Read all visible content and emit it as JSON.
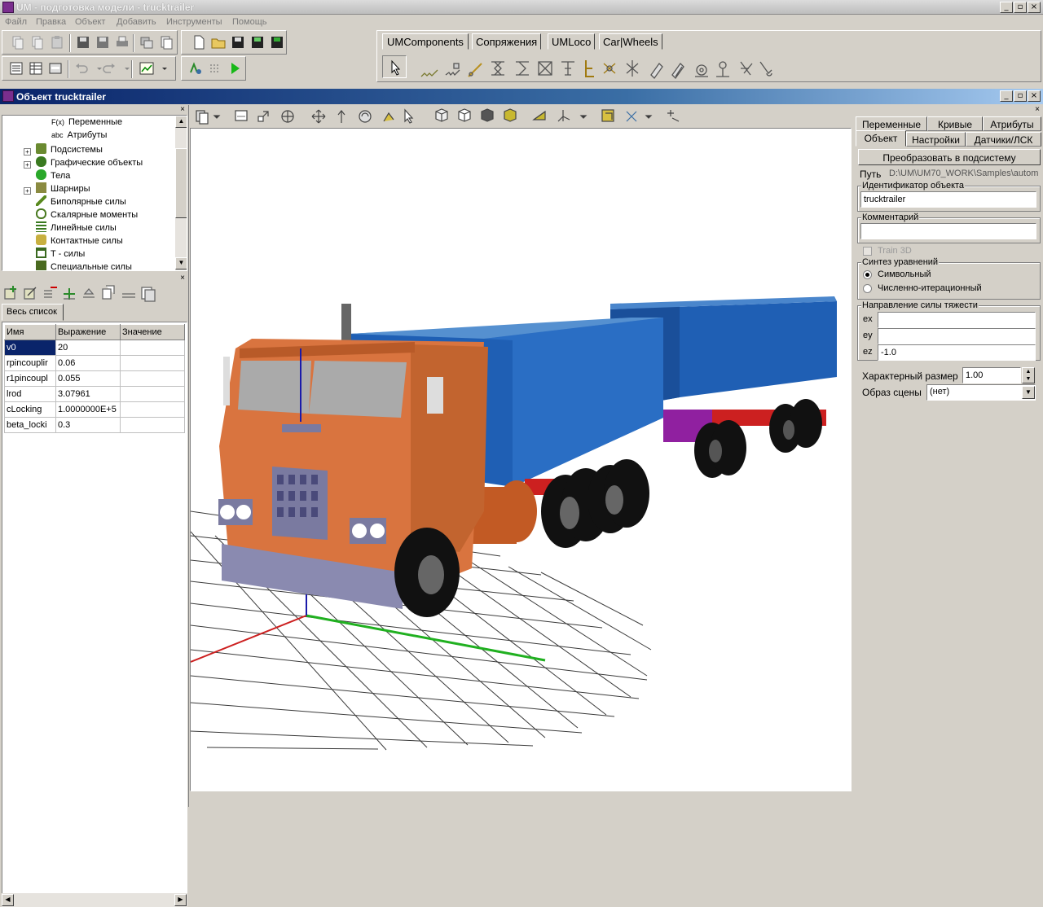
{
  "app": {
    "title": "UM - подготовка модели - trucktrailer",
    "menu": [
      "Файл",
      "Правка",
      "Объект",
      "Добавить",
      "Инструменты",
      "Помощь"
    ]
  },
  "toolbar": {
    "component_tabs": [
      "UMComponents",
      "Сопряжения",
      "UMLoco",
      "Car|Wheels"
    ]
  },
  "object_window": {
    "title": "Объект trucktrailer"
  },
  "tree": {
    "items": [
      {
        "label": "Переменные",
        "icon": "fx-icon",
        "prefix": "F(x)"
      },
      {
        "label": "Атрибуты",
        "icon": "abc-icon",
        "prefix": "abc"
      },
      {
        "label": "Подсистемы",
        "icon": "subsystems-icon"
      },
      {
        "label": "Графические объекты",
        "icon": "graphic-objects-icon"
      },
      {
        "label": "Тела",
        "icon": "bodies-icon"
      },
      {
        "label": "Шарниры",
        "icon": "joints-icon"
      },
      {
        "label": "Биполярные силы",
        "icon": "bipolar-force-icon"
      },
      {
        "label": "Скалярные моменты",
        "icon": "scalar-torque-icon"
      },
      {
        "label": "Линейные силы",
        "icon": "linear-force-icon"
      },
      {
        "label": "Контактные силы",
        "icon": "contact-force-icon"
      },
      {
        "label": "T - силы",
        "icon": "t-force-icon"
      },
      {
        "label": "Специальные силы",
        "icon": "special-force-icon"
      }
    ]
  },
  "variables": {
    "list_tab": "Весь список",
    "headers": [
      "Имя",
      "Выражение",
      "Значение"
    ],
    "rows": [
      {
        "name": "v0",
        "expr": "20",
        "value": ""
      },
      {
        "name": "rpincouplir",
        "expr": "0.06",
        "value": ""
      },
      {
        "name": "r1pincoupl",
        "expr": "0.055",
        "value": ""
      },
      {
        "name": "lrod",
        "expr": "3.07961",
        "value": ""
      },
      {
        "name": "cLocking",
        "expr": "1.0000000E+5",
        "value": ""
      },
      {
        "name": "beta_locki",
        "expr": "0.3",
        "value": ""
      }
    ]
  },
  "inspector": {
    "tabs_row1": [
      "Переменные",
      "Кривые",
      "Атрибуты"
    ],
    "tabs_row2": [
      "Объект",
      "Настройки",
      "Датчики/ЛСК"
    ],
    "convert_button": "Преобразовать в подсистему",
    "path_label": "Путь",
    "path_value": "D:\\UM\\UM70_WORK\\Samples\\autom",
    "identifier_label": "Идентификатор объекта",
    "identifier_value": "trucktrailer",
    "comment_label": "Комментарий",
    "comment_value": "",
    "train3d_label": "Train 3D",
    "synthesis_label": "Синтез уравнений",
    "synthesis_options": [
      "Символьный",
      "Численно-итерационный"
    ],
    "gravity_label": "Направление силы тяжести",
    "gravity": [
      {
        "axis": "ex",
        "value": ""
      },
      {
        "axis": "ey",
        "value": ""
      },
      {
        "axis": "ez",
        "value": "-1.0"
      }
    ],
    "char_size_label": "Характерный размер",
    "char_size_value": "1.00",
    "scene_label": "Образ сцены",
    "scene_value": "(нет)"
  },
  "colors": {
    "cab": "#d9743f",
    "cargo": "#1f5fb4",
    "grid_line": "#3a3a3a",
    "axis_x": "#cc2020",
    "axis_y": "#20b020",
    "axis_z": "#1a1aaa",
    "titlebar": "#0a246a"
  }
}
